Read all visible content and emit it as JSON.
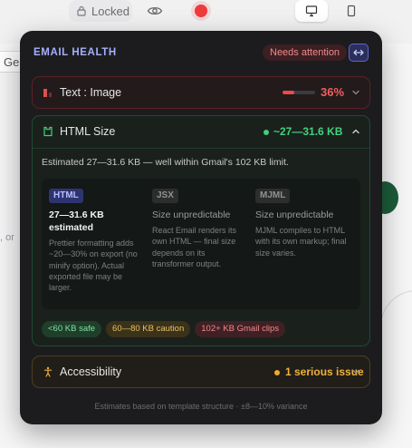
{
  "toolbar": {
    "locked_label": "Locked"
  },
  "background": {
    "input_fragment": "Ge",
    "text_fragment": ", or"
  },
  "panel": {
    "title": "EMAIL HEALTH",
    "status_badge": "Needs attention",
    "sections": {
      "text_image": {
        "label": "Text : Image",
        "value": "36%",
        "ratio": 0.36
      },
      "html_size": {
        "label": "HTML Size",
        "value": "~27—31.6 KB",
        "summary": "Estimated 27—31.6 KB — well within Gmail's 102 KB limit.",
        "cards": [
          {
            "tag": "HTML",
            "title": "27—31.6 KB estimated",
            "description": "Prettier formatting adds ~20—30% on export (no minify option). Actual exported file may be larger."
          },
          {
            "tag": "JSX",
            "title": "Size unpredictable",
            "description": "React Email renders its own HTML — final size depends on its transformer output."
          },
          {
            "tag": "MJML",
            "title": "Size unpredictable",
            "description": "MJML compiles to HTML with its own markup; final size varies."
          }
        ],
        "legend": [
          "<60 KB safe",
          "60—80 KB caution",
          "102+ KB Gmail clips"
        ]
      },
      "accessibility": {
        "label": "Accessibility",
        "value": "1 serious issue"
      }
    },
    "footer": "Estimates based on template structure · ±8—10% variance"
  },
  "colors": {
    "accent": "#a5b0ff",
    "danger": "#f25f5f",
    "success": "#43d17e",
    "warning": "#f0b23a"
  }
}
